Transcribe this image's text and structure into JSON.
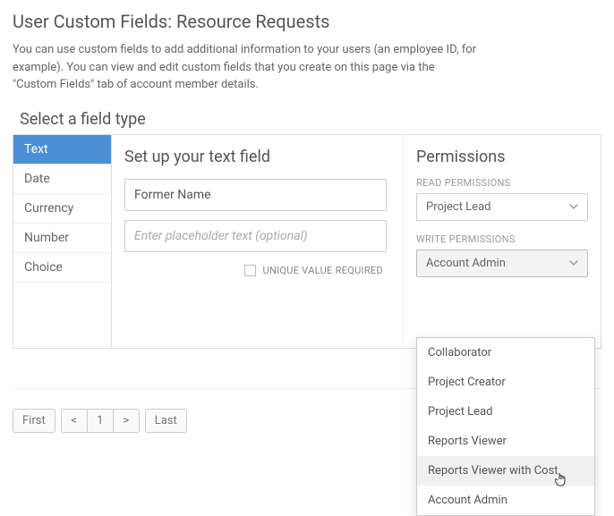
{
  "header": {
    "title": "User Custom Fields: Resource Requests",
    "description": "You can use custom fields to add additional information to your users (an employee ID, for example). You can view and edit custom fields that you create on this page via the \"Custom Fields\" tab of account member details."
  },
  "section": {
    "title": "Select a field type"
  },
  "field_types": [
    {
      "label": "Text",
      "active": true
    },
    {
      "label": "Date",
      "active": false
    },
    {
      "label": "Currency",
      "active": false
    },
    {
      "label": "Number",
      "active": false
    },
    {
      "label": "Choice",
      "active": false
    }
  ],
  "setup": {
    "heading": "Set up your text field",
    "name_value": "Former Name",
    "placeholder_placeholder": "Enter placeholder text (optional)",
    "unique_label": "UNIQUE VALUE REQUIRED",
    "unique_checked": false
  },
  "permissions": {
    "heading": "Permissions",
    "read_label": "READ PERMISSIONS",
    "read_value": "Project Lead",
    "write_label": "WRITE PERMISSIONS",
    "write_value": "Account Admin",
    "write_options": [
      "Collaborator",
      "Project Creator",
      "Project Lead",
      "Reports Viewer",
      "Reports Viewer with Cost",
      "Account Admin"
    ],
    "write_hover_index": 4
  },
  "pagination": {
    "first": "First",
    "prev": "<",
    "page": "1",
    "next": ">",
    "last": "Last"
  }
}
